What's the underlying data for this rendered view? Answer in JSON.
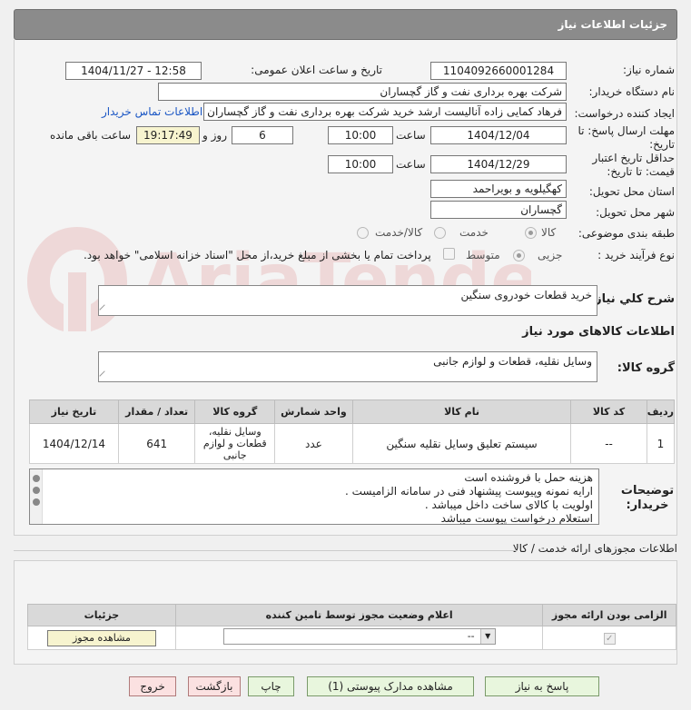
{
  "header": {
    "title": "جزئیات اطلاعات نیاز"
  },
  "labels": {
    "need_number": "شماره نیاز:",
    "announce_datetime": "تاریخ و ساعت اعلان عمومی:",
    "buyer_org": "نام دستگاه خریدار:",
    "requester": "ایجاد کننده درخواست:",
    "reply_deadline": "مهلت ارسال پاسخ: تا تاریخ:",
    "hour": "ساعت",
    "day_and": "روز و",
    "remaining": "ساعت باقی مانده",
    "price_validity": "حداقل تاریخ اعتبار قیمت: تا تاریخ:",
    "province": "استان محل تحویل:",
    "city": "شهر محل تحویل:",
    "category": "طبقه بندی موضوعی:",
    "purchase_type": "نوع فرآیند خرید :",
    "need_summary": "شرح کلي نياز:",
    "goods_info": "اطلاعات کالاهای مورد نیاز",
    "goods_group": "گروه کالا:",
    "buyer_notes": "توضیحات خریدار:"
  },
  "fields": {
    "need_number": "1104092660001284",
    "announce_datetime": "1404/11/27 - 12:58",
    "buyer_org": "شرکت بهره برداری نفت و گاز گچساران",
    "requester": "فرهاد کمایی زاده آنالیست ارشد خرید شرکت بهره برداری نفت و گاز گچساران",
    "contact_link": "اطلاعات تماس خریدار",
    "reply_date": "1404/12/04",
    "reply_time": "10:00",
    "days_left": "6",
    "time_left": "19:17:49",
    "price_date": "1404/12/29",
    "price_time": "10:00",
    "province": "کهگیلویه و بویراحمد",
    "city": "گچساران",
    "need_summary": "خرید قطعات خودروی سنگین",
    "goods_group": "وسایل نقلیه، قطعات و لوازم جانبی"
  },
  "category_options": [
    {
      "label": "کالا",
      "checked": true
    },
    {
      "label": "خدمت",
      "checked": false
    },
    {
      "label": "کالا/خدمت",
      "checked": false
    }
  ],
  "purchase_options": [
    {
      "label": "جزیی",
      "checked": true
    },
    {
      "label": "متوسط",
      "checked": false
    }
  ],
  "treasury_text": "پرداخت تمام یا بخشی از مبلغ خرید،از محل \"اسناد خزانه اسلامی\" خواهد بود.",
  "items_table": {
    "headers": [
      "ردیف",
      "کد کالا",
      "نام کالا",
      "واحد شمارش",
      "گروه کالا",
      "تعداد / مقدار",
      "تاریخ نیاز"
    ],
    "rows": [
      [
        "1",
        "--",
        "سیستم تعلیق وسایل نقلیه سنگین",
        "عدد",
        "وسایل نقلیه، قطعات و لوازم جانبی",
        "641",
        "1404/12/14"
      ]
    ]
  },
  "notes_lines": [
    "هزینه حمل با فروشنده است",
    "ارایه نمونه وپیوست پیشنهاد فنی در سامانه الزامیست .",
    "اولویت با کالای ساخت داخل میباشد .",
    "استعلام درخواست پیوست میباشد"
  ],
  "licenses": {
    "title": "اطلاعات مجوزهای ارائه خدمت / کالا",
    "headers": [
      "الزامی بودن ارائه مجوز",
      "اعلام وضعیت مجوز توسط تامین کننده",
      "جزئیات"
    ],
    "select_value": "--",
    "view_button": "مشاهده مجوز"
  },
  "buttons": {
    "reply": "پاسخ به نیاز",
    "attachments": "مشاهده مدارک پیوستی (1)",
    "print": "چاپ",
    "back": "بازگشت",
    "exit": "خروج"
  },
  "watermark": {
    "text": "AriaTender.net"
  }
}
